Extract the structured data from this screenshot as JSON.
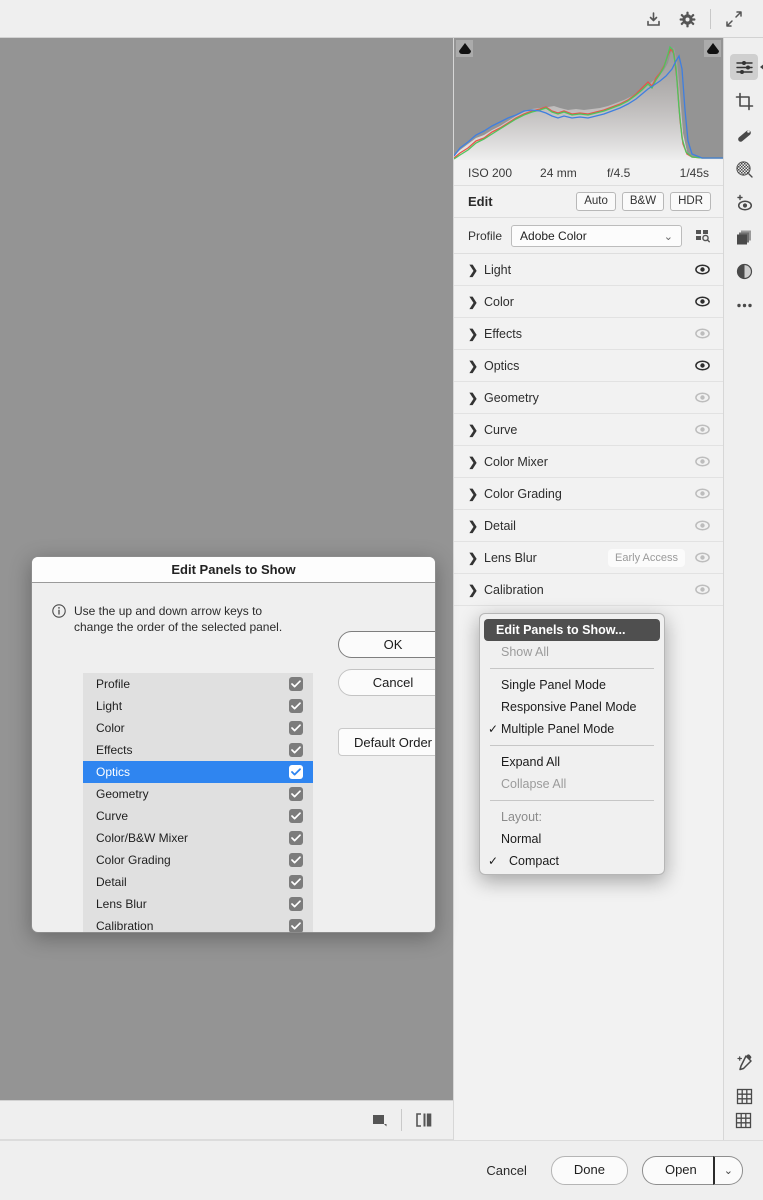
{
  "topbar": {
    "icons": [
      {
        "name": "download-icon"
      },
      {
        "name": "gear-icon"
      },
      {
        "name": "expand-icon"
      }
    ]
  },
  "histogram": {
    "exif": {
      "iso": "ISO 200",
      "focal": "24 mm",
      "aperture": "f/4.5",
      "shutter": "1/45s"
    },
    "clip_left": "shadow-clipping-indicator",
    "clip_right": "highlight-clipping-indicator",
    "colors": {
      "red": "#e8524a",
      "green": "#4fc45c",
      "blue": "#3f7fe0"
    }
  },
  "edit_header": {
    "title": "Edit",
    "buttons": [
      "Auto",
      "B&W",
      "HDR"
    ]
  },
  "profile": {
    "label": "Profile",
    "value": "Adobe Color",
    "browse_icon": "profile-browser-icon"
  },
  "panels": [
    {
      "label": "Light",
      "eye_active": true,
      "badge": ""
    },
    {
      "label": "Color",
      "eye_active": true,
      "badge": ""
    },
    {
      "label": "Effects",
      "eye_active": false,
      "badge": ""
    },
    {
      "label": "Optics",
      "eye_active": true,
      "badge": ""
    },
    {
      "label": "Geometry",
      "eye_active": false,
      "badge": ""
    },
    {
      "label": "Curve",
      "eye_active": false,
      "badge": ""
    },
    {
      "label": "Color Mixer",
      "eye_active": false,
      "badge": ""
    },
    {
      "label": "Color Grading",
      "eye_active": false,
      "badge": ""
    },
    {
      "label": "Detail",
      "eye_active": false,
      "badge": ""
    },
    {
      "label": "Lens Blur",
      "eye_active": false,
      "badge": "Early Access"
    },
    {
      "label": "Calibration",
      "eye_active": false,
      "badge": ""
    }
  ],
  "toolstrip": [
    {
      "name": "edit-sliders-icon",
      "selected": true
    },
    {
      "name": "crop-icon",
      "selected": false
    },
    {
      "name": "healing-brush-icon",
      "selected": false
    },
    {
      "name": "masking-icon",
      "selected": false
    },
    {
      "name": "red-eye-icon",
      "selected": false
    },
    {
      "name": "versions-icon",
      "selected": false
    },
    {
      "name": "presets-icon",
      "selected": false
    },
    {
      "name": "more-options-icon",
      "selected": false
    }
  ],
  "toolstrip_bottom": [
    {
      "name": "eyedropper-icon"
    },
    {
      "name": "grid-overlay-icon"
    }
  ],
  "canvas_toolbar": [
    {
      "name": "background-color-icon"
    },
    {
      "name": "before-after-view-icon"
    }
  ],
  "canvas_right_icon": {
    "name": "grid-view-icon"
  },
  "bottombar": {
    "cancel": "Cancel",
    "done": "Done",
    "open": "Open",
    "open_arrow": "chevron-down-icon"
  },
  "dialog": {
    "title": "Edit Panels to Show",
    "hint_icon": "info-icon",
    "hint": "Use the up and down arrow keys to change the order of the selected panel.",
    "ok": "OK",
    "cancel": "Cancel",
    "default_order": "Default Order",
    "items": [
      {
        "label": "Profile",
        "checked": true,
        "selected": false
      },
      {
        "label": "Light",
        "checked": true,
        "selected": false
      },
      {
        "label": "Color",
        "checked": true,
        "selected": false
      },
      {
        "label": "Effects",
        "checked": true,
        "selected": false
      },
      {
        "label": "Optics",
        "checked": true,
        "selected": true
      },
      {
        "label": "Geometry",
        "checked": true,
        "selected": false
      },
      {
        "label": "Curve",
        "checked": true,
        "selected": false
      },
      {
        "label": "Color/B&W Mixer",
        "checked": true,
        "selected": false
      },
      {
        "label": "Color Grading",
        "checked": true,
        "selected": false
      },
      {
        "label": "Detail",
        "checked": true,
        "selected": false
      },
      {
        "label": "Lens Blur",
        "checked": true,
        "selected": false
      },
      {
        "label": "Calibration",
        "checked": true,
        "selected": false
      }
    ]
  },
  "context_menu": {
    "items": [
      {
        "label": "Edit Panels to Show...",
        "state": "highlighted",
        "check": false,
        "indent": false
      },
      {
        "label": "Show All",
        "state": "disabled",
        "check": false,
        "indent": false
      },
      {
        "separator": true
      },
      {
        "label": "Single Panel Mode",
        "state": "normal",
        "check": false,
        "indent": false
      },
      {
        "label": "Responsive Panel Mode",
        "state": "normal",
        "check": false,
        "indent": false
      },
      {
        "label": "Multiple Panel Mode",
        "state": "normal",
        "check": true,
        "indent": false
      },
      {
        "separator": true
      },
      {
        "label": "Expand All",
        "state": "normal",
        "check": false,
        "indent": false
      },
      {
        "label": "Collapse All",
        "state": "disabled",
        "check": false,
        "indent": false
      },
      {
        "separator": true
      },
      {
        "label": "Layout:",
        "state": "header",
        "check": false,
        "indent": false
      },
      {
        "label": "Normal",
        "state": "normal",
        "check": false,
        "indent": true
      },
      {
        "label": "Compact",
        "state": "normal",
        "check": true,
        "indent": true
      }
    ]
  },
  "colors": {
    "accent": "#2f85f0",
    "panel_bg": "#f2f2f2",
    "canvas_bg": "#949494",
    "menu_highlight": "#4f4f4f"
  }
}
